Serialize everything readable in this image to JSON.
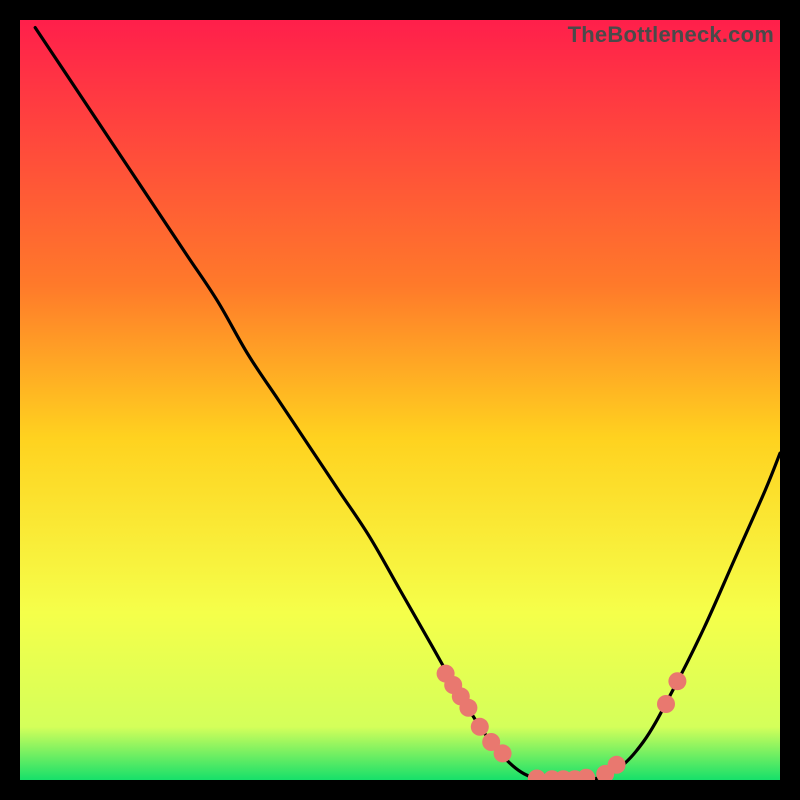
{
  "watermark": "TheBottleneck.com",
  "chart_data": {
    "type": "line",
    "title": "",
    "xlabel": "",
    "ylabel": "",
    "xlim": [
      0,
      100
    ],
    "ylim": [
      0,
      100
    ],
    "gradient_stops": [
      {
        "offset": 0,
        "color": "#ff1f4b"
      },
      {
        "offset": 35,
        "color": "#ff7a2a"
      },
      {
        "offset": 55,
        "color": "#ffd21f"
      },
      {
        "offset": 78,
        "color": "#f5ff4a"
      },
      {
        "offset": 93,
        "color": "#d4ff5a"
      },
      {
        "offset": 100,
        "color": "#16e06a"
      }
    ],
    "series": [
      {
        "name": "bottleneck-curve",
        "x": [
          2,
          6,
          10,
          14,
          18,
          22,
          26,
          30,
          34,
          38,
          42,
          46,
          50,
          54,
          58,
          62,
          66,
          70,
          74,
          78,
          82,
          86,
          90,
          94,
          98,
          100
        ],
        "y": [
          99,
          93,
          87,
          81,
          75,
          69,
          63,
          56,
          50,
          44,
          38,
          32,
          25,
          18,
          11,
          5,
          1,
          0,
          0,
          1,
          5,
          12,
          20,
          29,
          38,
          43
        ]
      }
    ],
    "markers": {
      "name": "highlight-points",
      "color": "#e9786f",
      "radius": 9,
      "x": [
        56,
        57,
        58,
        59,
        60.5,
        62,
        63.5,
        68,
        70,
        71.5,
        73,
        74.5,
        77,
        78.5,
        85,
        86.5
      ],
      "y": [
        14,
        12.5,
        11,
        9.5,
        7,
        5,
        3.5,
        0.2,
        0.1,
        0.1,
        0.1,
        0.3,
        0.8,
        2,
        10,
        13
      ]
    }
  }
}
